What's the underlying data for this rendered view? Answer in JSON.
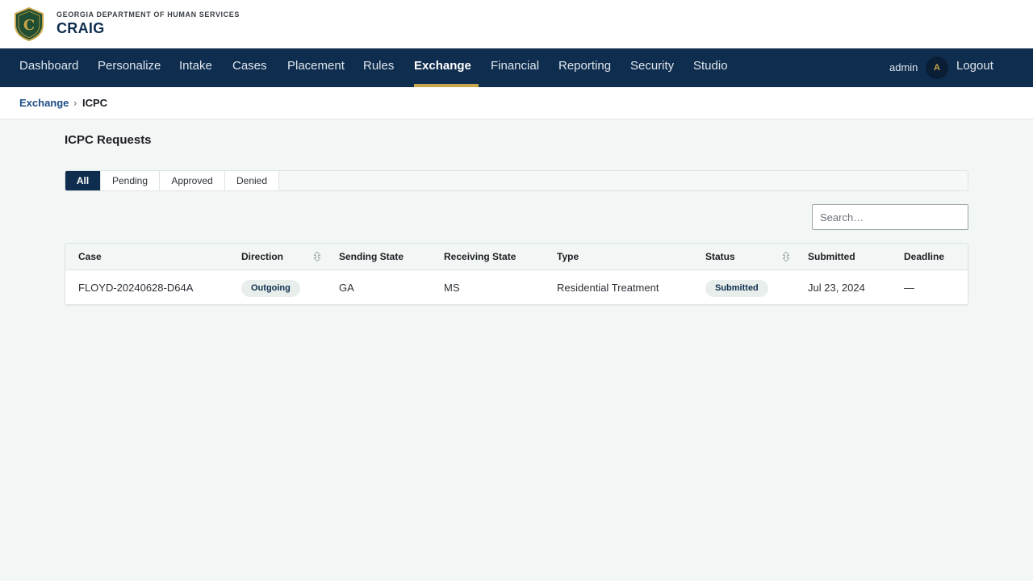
{
  "header": {
    "agency": "GEORGIA DEPARTMENT OF HUMAN SERVICES",
    "app_name": "CRAIG",
    "logo_letter": "C",
    "logo_icon": "shield-icon"
  },
  "nav": {
    "items": [
      {
        "label": "Dashboard"
      },
      {
        "label": "Personalize"
      },
      {
        "label": "Intake"
      },
      {
        "label": "Cases"
      },
      {
        "label": "Placement"
      },
      {
        "label": "Rules"
      },
      {
        "label": "Exchange",
        "active": true
      },
      {
        "label": "Financial"
      },
      {
        "label": "Reporting"
      },
      {
        "label": "Security"
      },
      {
        "label": "Studio"
      }
    ],
    "user": "admin",
    "avatar_initial": "A",
    "logout_label": "Logout"
  },
  "breadcrumb": {
    "parent": "Exchange",
    "separator": "›",
    "current": "ICPC"
  },
  "page": {
    "title": "ICPC Requests"
  },
  "tabs": [
    {
      "label": "All",
      "active": true
    },
    {
      "label": "Pending"
    },
    {
      "label": "Approved"
    },
    {
      "label": "Denied"
    }
  ],
  "search": {
    "placeholder": "Search…",
    "value": ""
  },
  "table": {
    "columns": [
      {
        "label": "Case"
      },
      {
        "label": "Direction",
        "sortable": true
      },
      {
        "label": "Sending State"
      },
      {
        "label": "Receiving State"
      },
      {
        "label": "Type"
      },
      {
        "label": "Status",
        "sortable": true
      },
      {
        "label": "Submitted"
      },
      {
        "label": "Deadline"
      }
    ],
    "rows": [
      {
        "case": "FLOYD-20240628-D64A",
        "direction": "Outgoing",
        "sending_state": "GA",
        "receiving_state": "MS",
        "type": "Residential Treatment",
        "status": "Submitted",
        "submitted": "Jul 23, 2024",
        "deadline": "—"
      }
    ]
  },
  "colors": {
    "nav_bg": "#0f2d4e",
    "accent_gold": "#c9a64a",
    "logo_green": "#1f4e32",
    "link_blue": "#1d4e86",
    "page_bg": "#f2f6f4"
  }
}
